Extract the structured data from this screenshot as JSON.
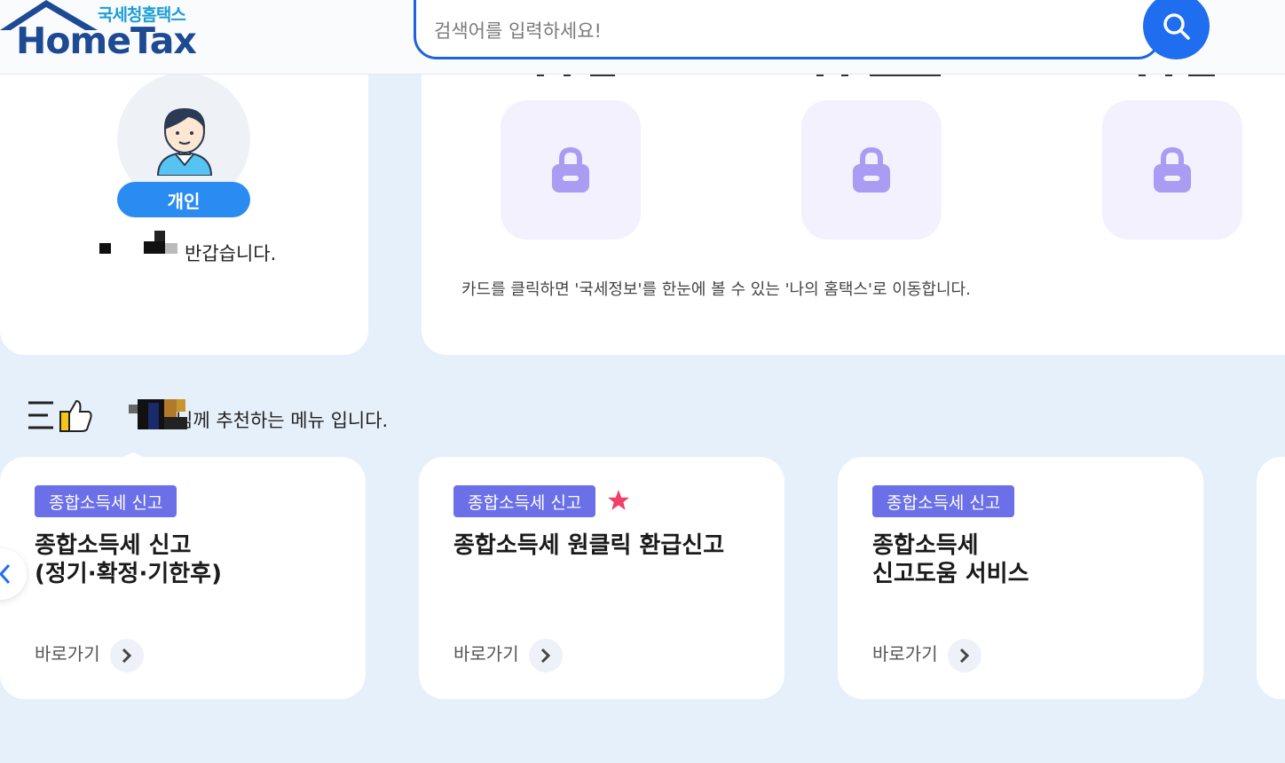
{
  "header": {
    "logo_ko": "국세청홈택스",
    "logo_en": "HomeTax",
    "search_placeholder": "검색어를 입력하세요!",
    "search_icon": "search-icon"
  },
  "profile": {
    "badge": "개인",
    "greeting": "반갑습니다."
  },
  "info": {
    "description": "카드를 클릭하면 '국세정보'를 한눈에 볼 수 있는 '나의 홈택스'로 이동합니다.",
    "lock_icon": "lock-icon"
  },
  "recommend": {
    "text": "님께 추천하는 메뉴 입니다."
  },
  "menu_cards": [
    {
      "tag": "종합소득세 신고",
      "title": "종합소득세 신고\n(정기·확정·기한후)",
      "goto": "바로가기"
    },
    {
      "tag": "종합소득세 신고",
      "title": "종합소득세 원클릭 환급신고",
      "goto": "바로가기"
    },
    {
      "tag": "종합소득세 신고",
      "title": "종합소득세\n신고도움 서비스",
      "goto": "바로가기"
    }
  ],
  "colors": {
    "accent": "#1f6ef0",
    "tag": "#6b6fe8",
    "lock": "#a99cf2",
    "star": "#f0406a"
  }
}
